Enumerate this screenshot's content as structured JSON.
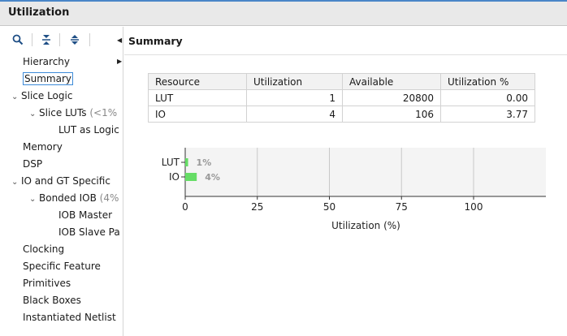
{
  "window": {
    "title": "Utilization"
  },
  "toolbar": {
    "icons": [
      "search-icon",
      "collapse-all-icon",
      "expand-all-icon"
    ]
  },
  "tree": [
    {
      "label": "Hierarchy",
      "suffix": "",
      "level": 0,
      "chevron": false
    },
    {
      "label": "Summary",
      "suffix": "",
      "level": 0,
      "chevron": false,
      "selected": true
    },
    {
      "label": "Slice Logic",
      "suffix": "",
      "level": 0,
      "chevron": true
    },
    {
      "label": "Slice LUTs",
      "suffix": " (<1%",
      "level": 1,
      "chevron": true
    },
    {
      "label": "LUT as Logic",
      "suffix": "",
      "level": 2,
      "chevron": false
    },
    {
      "label": "Memory",
      "suffix": "",
      "level": 0,
      "chevron": false
    },
    {
      "label": "DSP",
      "suffix": "",
      "level": 0,
      "chevron": false
    },
    {
      "label": "IO and GT Specific",
      "suffix": "",
      "level": 0,
      "chevron": true
    },
    {
      "label": "Bonded IOB",
      "suffix": " (4%",
      "level": 1,
      "chevron": true
    },
    {
      "label": "IOB Master",
      "suffix": "",
      "level": 2,
      "chevron": false
    },
    {
      "label": "IOB Slave Pa",
      "suffix": "",
      "level": 2,
      "chevron": false
    },
    {
      "label": "Clocking",
      "suffix": "",
      "level": 0,
      "chevron": false
    },
    {
      "label": "Specific Feature",
      "suffix": "",
      "level": 0,
      "chevron": false
    },
    {
      "label": "Primitives",
      "suffix": "",
      "level": 0,
      "chevron": false
    },
    {
      "label": "Black Boxes",
      "suffix": "",
      "level": 0,
      "chevron": false
    },
    {
      "label": "Instantiated Netlist",
      "suffix": "",
      "level": 0,
      "chevron": false
    }
  ],
  "summary": {
    "title": "Summary",
    "columns": [
      "Resource",
      "Utilization",
      "Available",
      "Utilization %"
    ],
    "rows": [
      [
        "LUT",
        "1",
        "20800",
        "0.00"
      ],
      [
        "IO",
        "4",
        "106",
        "3.77"
      ]
    ]
  },
  "chart_data": {
    "type": "bar",
    "orientation": "horizontal",
    "categories": [
      "LUT",
      "IO"
    ],
    "values": [
      1,
      4
    ],
    "data_labels": [
      "1%",
      "4%"
    ],
    "xlabel": "Utilization (%)",
    "ylabel": "",
    "xlim": [
      0,
      125
    ],
    "xticks": [
      0,
      25,
      50,
      75,
      100
    ],
    "grid": true,
    "bar_color": "#66dd66",
    "label_color": "#999999"
  },
  "colors": {
    "selection_border": "#3c8ad8",
    "title_border": "#4a86c8"
  }
}
